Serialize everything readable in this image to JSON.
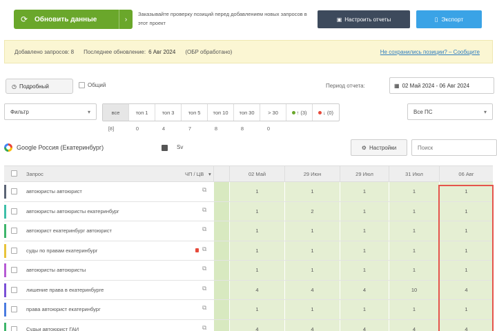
{
  "header": {
    "update_button": "Обновить данные",
    "description": "Заказывайте проверку позиций перед добавлением новых запросов в этот проект",
    "report_button": "Настроить отчеты",
    "export_button": "Экспорт"
  },
  "info": {
    "requests_label": "Добавлено запросов: 8",
    "last_update_label": "Последнее обновление:",
    "last_update_value": "6 Авг 2024",
    "status": "(ОБР обработано)",
    "help_link": "Не сохранились позиции? – Сообщите"
  },
  "mode": {
    "detailed_label": "Подробный",
    "summary_label": "Общий",
    "period_label": "Период отчета:",
    "date_range": "02 Май 2024 - 06 Авг 2024"
  },
  "filters": {
    "left_select": "Фильтр",
    "segments": [
      {
        "label": "все",
        "active": true,
        "count": "[8]"
      },
      {
        "label": "топ 1",
        "active": false,
        "count": "0"
      },
      {
        "label": "топ 3",
        "active": false,
        "count": "4"
      },
      {
        "label": "топ 5",
        "active": false,
        "count": "7"
      },
      {
        "label": "топ 10",
        "active": false,
        "count": "8"
      },
      {
        "label": "топ 30",
        "active": false,
        "count": "8"
      },
      {
        "label": "> 30",
        "active": false,
        "count": "0"
      },
      {
        "label": "↑ (3)",
        "active": false,
        "count": "",
        "dot": "#6aa72b"
      },
      {
        "label": "↓ (0)",
        "active": false,
        "count": "",
        "dot": "#e64a3b"
      }
    ],
    "right_select": "Все ПС"
  },
  "engine": {
    "name": "Google Россия (Екатеринбург)",
    "extra": "Sv",
    "settings_button": "Настройки",
    "search_placeholder": "Поиск"
  },
  "table": {
    "headers": {
      "query": "Запрос",
      "volume": "ЧП / ЦВ",
      "dates": [
        "02 Май",
        "29 Июн",
        "29 Июл",
        "31 Июл",
        "06 Авг"
      ]
    },
    "rows": [
      {
        "keyword": "автоюристы автоюрист",
        "marker": "#5b6475",
        "values": [
          "1",
          "1",
          "1",
          "1",
          "1"
        ],
        "red": false
      },
      {
        "keyword": "автоюристы автоюристы екатеринбург",
        "marker": "#3dbfa8",
        "values": [
          "1",
          "2",
          "1",
          "1",
          "1"
        ],
        "red": false
      },
      {
        "keyword": "автоюрист екатеринбург автоюрист",
        "marker": "#3db56a",
        "values": [
          "1",
          "1",
          "1",
          "1",
          "1"
        ],
        "red": false
      },
      {
        "keyword": "суды по правам екатеринбург",
        "marker": "#e8c33a",
        "values": [
          "1",
          "1",
          "1",
          "1",
          "1"
        ],
        "red": true
      },
      {
        "keyword": "автоюристы автоюристы",
        "marker": "#b65bd4",
        "values": [
          "1",
          "1",
          "1",
          "1",
          "1"
        ],
        "red": false
      },
      {
        "keyword": "лишение права в екатеринбурге",
        "marker": "#7a4fd6",
        "values": [
          "4",
          "4",
          "4",
          "10",
          "4"
        ],
        "red": false
      },
      {
        "keyword": "права автоюрист екатеринбург",
        "marker": "#4a7be0",
        "values": [
          "1",
          "1",
          "1",
          "1",
          "1"
        ],
        "red": false
      },
      {
        "keyword": "Судьи автоюрист ГАИ",
        "marker": "#3db56a",
        "values": [
          "4",
          "4",
          "4",
          "4",
          "4"
        ],
        "red": false
      }
    ]
  },
  "colors": {
    "accent_green": "#6aa72b",
    "dark_button": "#3d4a5c",
    "blue_button": "#3aa3e6",
    "cell_green": "#e5efd3",
    "highlight": "#e5534b"
  }
}
